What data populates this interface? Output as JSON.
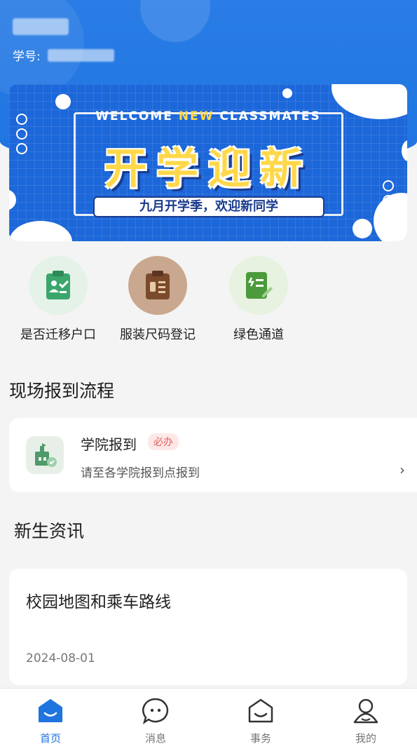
{
  "header": {
    "user_name": "",
    "student_id_label": "学号:",
    "student_id_value": ""
  },
  "banner": {
    "top_text_pre": "WELCOME ",
    "top_text_hl": "NEW",
    "top_text_post": " CLASSMATES",
    "title": "开学迎新",
    "subtitle": "九月开学季，欢迎新同学"
  },
  "quick_actions": [
    {
      "label": "是否迁移户口",
      "icon": "clipboard-check-icon",
      "color": "#3aa66b"
    },
    {
      "label": "服装尺码登记",
      "icon": "clipboard-list-icon",
      "color": "#7b4a2c"
    },
    {
      "label": "绿色通道",
      "icon": "note-pen-icon",
      "color": "#4b9a3b"
    }
  ],
  "process": {
    "section_title": "现场报到流程",
    "item_title": "学院报到",
    "item_badge": "必办",
    "item_desc": "请至各学院报到点报到",
    "chevron": "›"
  },
  "news": {
    "section_title": "新生资讯",
    "items": [
      {
        "title": "校园地图和乘车路线",
        "date": "2024-08-01"
      }
    ]
  },
  "tabbar": {
    "tabs": [
      {
        "label": "首页",
        "icon": "home-icon",
        "active": true
      },
      {
        "label": "消息",
        "icon": "message-icon",
        "active": false
      },
      {
        "label": "事务",
        "icon": "affairs-icon",
        "active": false
      },
      {
        "label": "我的",
        "icon": "user-icon",
        "active": false
      }
    ],
    "active_color": "#1f74e0"
  }
}
